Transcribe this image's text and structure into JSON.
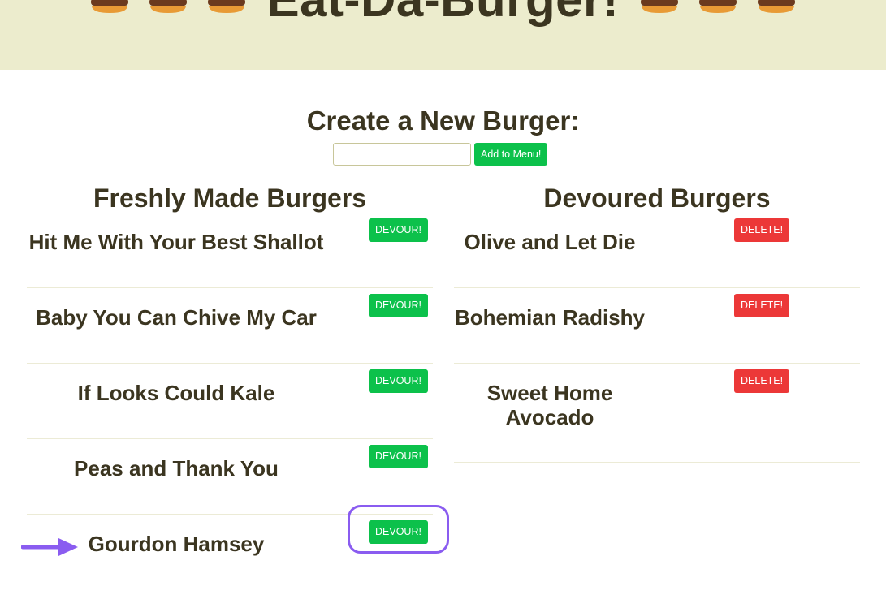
{
  "header": {
    "title": "Eat-Da-Burger!",
    "icon_left": [
      "burger-icon",
      "burger-icon",
      "burger-icon"
    ],
    "icon_right": [
      "burger-icon",
      "burger-icon",
      "burger-icon"
    ],
    "background": "#ececcd"
  },
  "create": {
    "title": "Create a New Burger:",
    "input_value": "",
    "button_label": "Add to Menu!"
  },
  "fresh": {
    "title": "Freshly Made Burgers",
    "button_label": "DEVOUR!",
    "items": [
      {
        "name": "Hit Me With Your Best Shallot"
      },
      {
        "name": "Baby You Can Chive My Car"
      },
      {
        "name": "If Looks Could Kale"
      },
      {
        "name": "Peas and Thank You"
      },
      {
        "name": "Gourdon Hamsey"
      }
    ]
  },
  "devoured": {
    "title": "Devoured Burgers",
    "button_label": "DELETE!",
    "items": [
      {
        "name": "Olive and Let Die"
      },
      {
        "name": "Bohemian Radishy"
      },
      {
        "name": "Sweet Home Avocado"
      }
    ]
  },
  "colors": {
    "green": "#0cc14b",
    "red": "#ec3838",
    "text": "#3b3520",
    "annotation": "#8a5cf0"
  }
}
